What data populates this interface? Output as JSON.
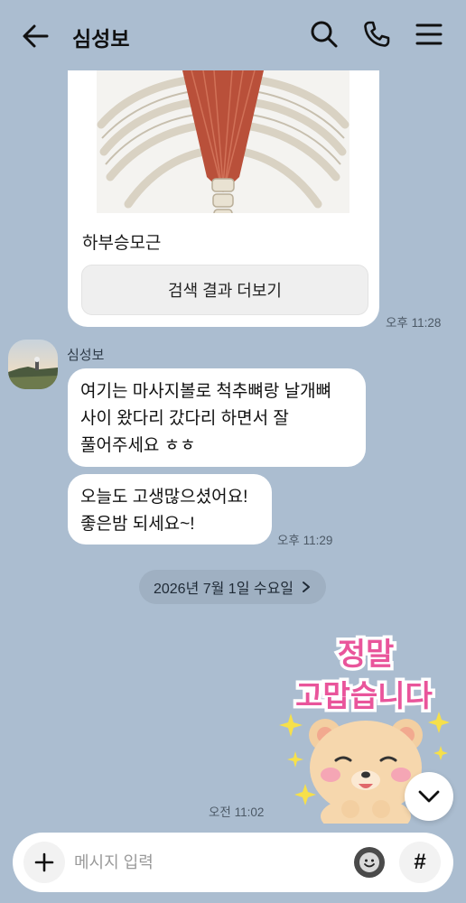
{
  "header": {
    "title": "심성보",
    "back_icon": "arrow-left-icon",
    "search_icon": "search-icon",
    "call_icon": "phone-icon",
    "menu_icon": "hamburger-menu-icon"
  },
  "search_card": {
    "image_icon": "anatomy-image",
    "title": "하부승모근",
    "more_label": "검색 결과 더보기",
    "time": "오후 11:28"
  },
  "incoming": {
    "sender": "심성보",
    "messages": [
      "여기는 마사지볼로 척추뼈랑 날개뼈\n사이 왔다리 갔다리 하면서 잘\n풀어주세요 ㅎㅎ",
      "오늘도 고생많으셨어요!\n좋은밤 되세요~!"
    ],
    "time": "오후 11:29"
  },
  "date_divider": {
    "label": "2026년 7월 1일 수요일",
    "icon": "chevron-right-icon"
  },
  "sticker": {
    "text_line1": "정말",
    "text_line2": "고맙습니다",
    "time": "오전 11:02"
  },
  "input_bar": {
    "placeholder": "메시지 입력",
    "plus_icon": "plus-icon",
    "emoji_icon": "emoji-icon",
    "hash_label": "#"
  },
  "colors": {
    "background": "#abbdd0",
    "bubble": "#ffffff",
    "sticker_pink": "#e9559b"
  }
}
